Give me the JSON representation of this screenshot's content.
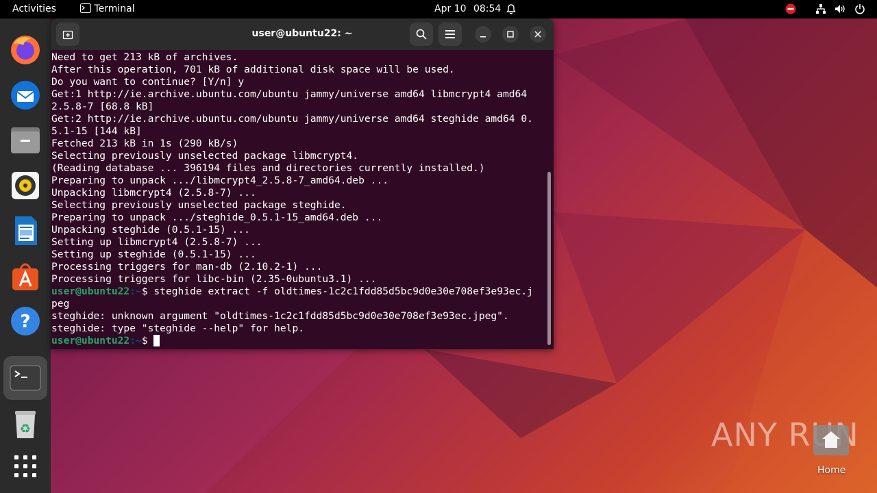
{
  "topbar": {
    "activities": "Activities",
    "app_name": "Terminal",
    "date": "Apr 10",
    "time": "08:54"
  },
  "dock": {
    "apps": [
      {
        "name": "Firefox",
        "icon": "firefox-icon"
      },
      {
        "name": "Thunderbird",
        "icon": "thunderbird-icon"
      },
      {
        "name": "Files",
        "icon": "files-icon"
      },
      {
        "name": "Rhythmbox",
        "icon": "rhythmbox-icon"
      },
      {
        "name": "LibreOffice Writer",
        "icon": "writer-icon"
      },
      {
        "name": "Ubuntu Software",
        "icon": "software-icon"
      },
      {
        "name": "Help",
        "icon": "help-icon"
      },
      {
        "name": "Terminal",
        "icon": "terminal-icon",
        "active": true
      },
      {
        "name": "Trash",
        "icon": "trash-icon"
      },
      {
        "name": "Show Applications",
        "icon": "app-grid-icon"
      }
    ]
  },
  "terminal": {
    "title": "user@ubuntu22: ~",
    "lines": [
      "Need to get 213 kB of archives.",
      "After this operation, 701 kB of additional disk space will be used.",
      "Do you want to continue? [Y/n] y",
      "Get:1 http://ie.archive.ubuntu.com/ubuntu jammy/universe amd64 libmcrypt4 amd64",
      "2.5.8-7 [68.8 kB]",
      "Get:2 http://ie.archive.ubuntu.com/ubuntu jammy/universe amd64 steghide amd64 0.",
      "5.1-15 [144 kB]",
      "Fetched 213 kB in 1s (290 kB/s)",
      "Selecting previously unselected package libmcrypt4.",
      "(Reading database ... 396194 files and directories currently installed.)",
      "Preparing to unpack .../libmcrypt4_2.5.8-7_amd64.deb ...",
      "Unpacking libmcrypt4 (2.5.8-7) ...",
      "Selecting previously unselected package steghide.",
      "Preparing to unpack .../steghide_0.5.1-15_amd64.deb ...",
      "Unpacking steghide (0.5.1-15) ...",
      "Setting up libmcrypt4 (2.5.8-7) ...",
      "Setting up steghide (0.5.1-15) ...",
      "Processing triggers for man-db (2.10.2-1) ...",
      "Processing triggers for libc-bin (2.35-0ubuntu3.1) ..."
    ],
    "prompt_user": "user@ubuntu22",
    "prompt_path": ":~",
    "prompt_symbol": "$",
    "command": " steghide extract -f oldtimes-1c2c1fdd85d5bc9d0e30e708ef3e93ec.j",
    "command_wrap": "peg",
    "output": [
      "steghide: unknown argument \"oldtimes-1c2c1fdd85d5bc9d0e30e708ef3e93ec.jpeg\".",
      "steghide: type \"steghide --help\" for help."
    ]
  },
  "desktop": {
    "watermark": "ANY RUN",
    "home_label": "Home"
  },
  "colors": {
    "terminal_bg": "#300a24",
    "prompt_user": "#26a269",
    "prompt_path": "#12488b",
    "ubuntu_orange": "#e95420"
  }
}
